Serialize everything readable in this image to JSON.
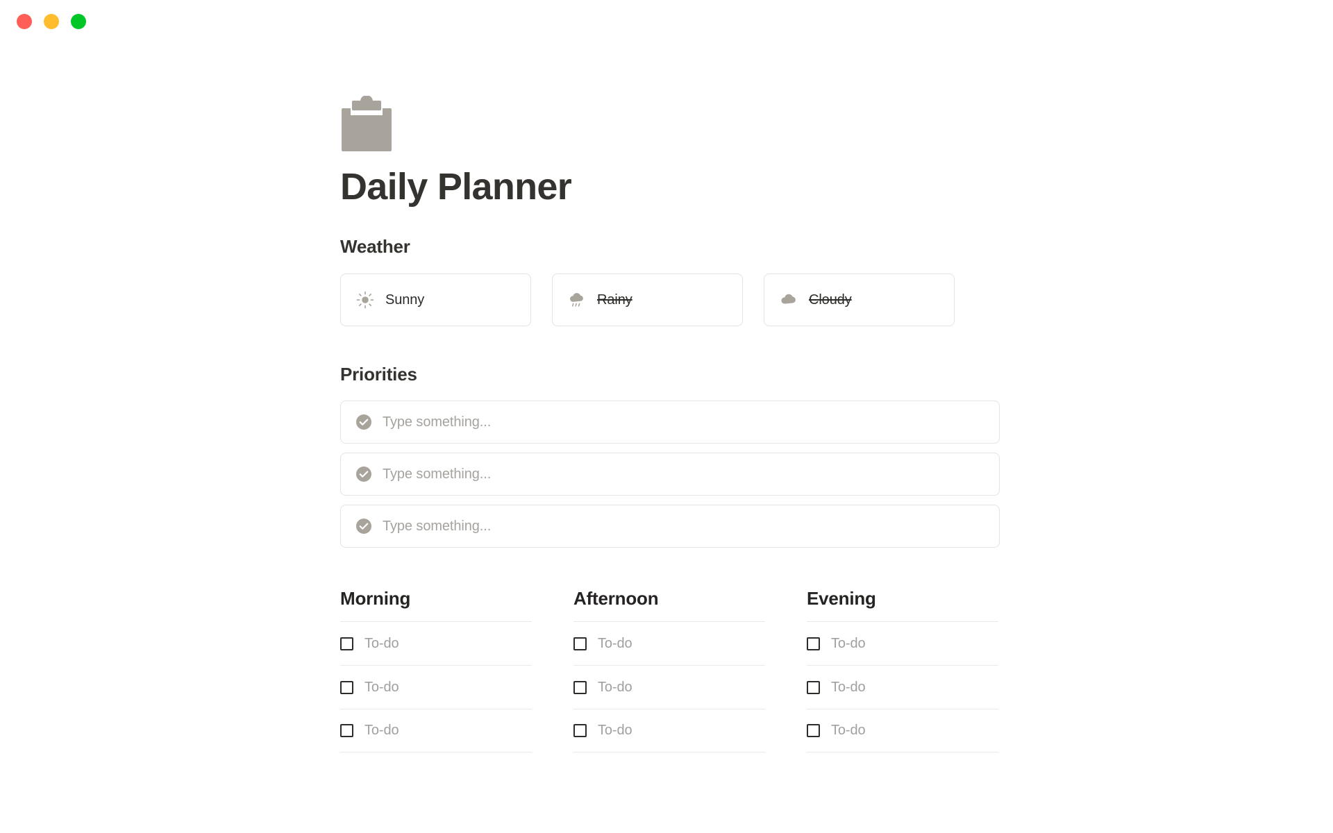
{
  "window": {
    "controls": [
      {
        "name": "close",
        "label": "Close",
        "color": "#ff5f57"
      },
      {
        "name": "minimize",
        "label": "Minimize",
        "color": "#ffbd2e"
      },
      {
        "name": "maximize",
        "label": "Maximize",
        "color": "#00c627"
      }
    ]
  },
  "header": {
    "icon": "clipboard-icon",
    "icon_color": "#a8a49c",
    "title": "Daily Planner"
  },
  "weather": {
    "heading": "Weather",
    "options": [
      {
        "label": "Sunny",
        "icon": "sun-icon",
        "struck": false
      },
      {
        "label": "Rainy",
        "icon": "cloud-rain-icon",
        "struck": true
      },
      {
        "label": "Cloudy",
        "icon": "cloud-icon",
        "struck": true
      }
    ]
  },
  "priorities": {
    "heading": "Priorities",
    "items": [
      {
        "icon": "check-circle-icon",
        "value": "",
        "placeholder": "Type something..."
      },
      {
        "icon": "check-circle-icon",
        "value": "",
        "placeholder": "Type something..."
      },
      {
        "icon": "check-circle-icon",
        "value": "",
        "placeholder": "Type something..."
      }
    ]
  },
  "schedule": {
    "columns": [
      {
        "heading": "Morning",
        "todos": [
          {
            "label": "To-do",
            "checked": false
          },
          {
            "label": "To-do",
            "checked": false
          },
          {
            "label": "To-do",
            "checked": false
          }
        ]
      },
      {
        "heading": "Afternoon",
        "todos": [
          {
            "label": "To-do",
            "checked": false
          },
          {
            "label": "To-do",
            "checked": false
          },
          {
            "label": "To-do",
            "checked": false
          }
        ]
      },
      {
        "heading": "Evening",
        "todos": [
          {
            "label": "To-do",
            "checked": false
          },
          {
            "label": "To-do",
            "checked": false
          },
          {
            "label": "To-do",
            "checked": false
          }
        ]
      }
    ]
  },
  "colors": {
    "text_primary": "#35332f",
    "text_muted": "#a0a0a0",
    "icon_gray": "#a8a49c",
    "border": "#e4e3e1",
    "divider": "#ebeae8",
    "background": "#ffffff"
  }
}
